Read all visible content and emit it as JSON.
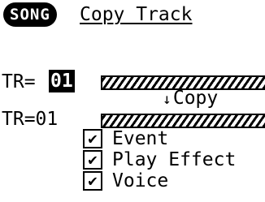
{
  "header": {
    "mode": "SONG",
    "title": "Copy Track"
  },
  "source": {
    "label": "TR=",
    "value": "01"
  },
  "copy": {
    "arrow_icon": "down-arrow-icon",
    "arrow": "↓",
    "label": "Copy"
  },
  "destination": {
    "label": "TR=01"
  },
  "options": [
    {
      "label": "Event",
      "checked": true,
      "mark": "✔"
    },
    {
      "label": "Play Effect",
      "checked": true,
      "mark": "✔"
    },
    {
      "label": "Voice",
      "checked": true,
      "mark": "✔"
    }
  ]
}
